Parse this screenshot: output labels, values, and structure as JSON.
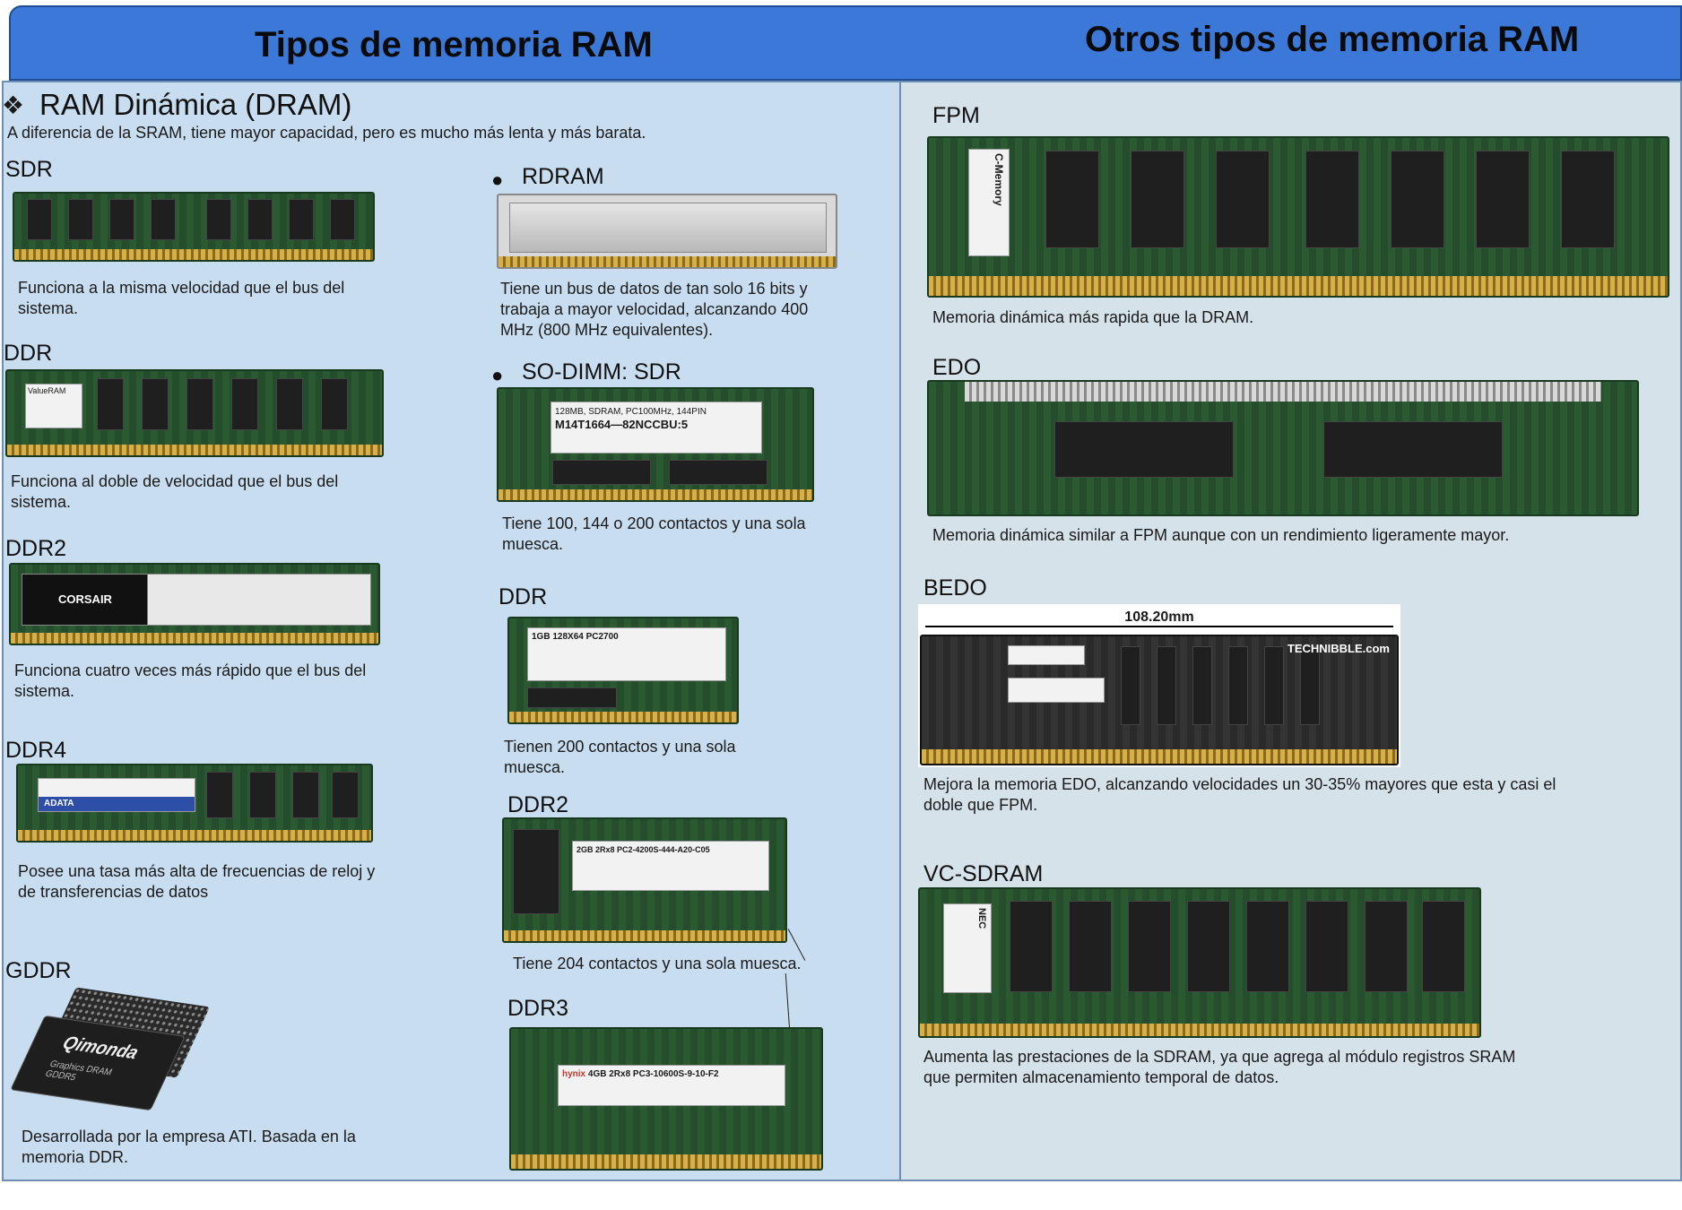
{
  "header": {
    "left_title": "Tipos de memoria RAM",
    "right_title": "Otros tipos de memoria RAM"
  },
  "colors": {
    "header_bg": "#3c78d8",
    "left_panel_bg": "#c9ddf1",
    "right_panel_bg": "#d5e2ea",
    "pcb_green": "#2b5a32",
    "pins_gold": "#d8b04a"
  },
  "left": {
    "section_symbol": "❖",
    "section_title": "RAM Dinámica (DRAM)",
    "section_intro": "A diferencia de la SRAM, tiene mayor capacidad, pero es mucho más lenta y más barata.",
    "col1": [
      {
        "label": "SDR",
        "desc": "Funciona a la misma velocidad que el bus del sistema."
      },
      {
        "label": "DDR",
        "desc": "Funciona al doble de velocidad que el bus del sistema."
      },
      {
        "label": "DDR2",
        "desc": "Funciona cuatro veces más rápido que el bus del sistema."
      },
      {
        "label": "DDR4",
        "desc": "Posee una tasa más alta de frecuencias de reloj y de transferencias de datos"
      },
      {
        "label": "GDDR",
        "desc": "Desarrollada por la empresa ATI. Basada en la memoria DDR."
      }
    ],
    "col2": [
      {
        "bullet": "●",
        "label": "RDRAM",
        "desc": "Tiene un bus de datos de tan solo 16 bits y trabaja a mayor velocidad, alcanzando 400 MHz (800 MHz equivalentes)."
      },
      {
        "bullet": "●",
        "label": "SO-DIMM: SDR",
        "desc": "Tiene 100, 144 o 200 contactos y una sola muesca."
      },
      {
        "label": "DDR",
        "desc": "Tienen 200 contactos y una sola muesca."
      },
      {
        "label": "DDR2",
        "desc": "Tiene 204 contactos y una sola muesca."
      },
      {
        "label": "DDR3",
        "desc": ""
      }
    ]
  },
  "right": {
    "items": [
      {
        "label": "FPM",
        "desc": "Memoria dinámica más rapida que la DRAM."
      },
      {
        "label": "EDO",
        "desc": "Memoria dinámica similar a FPM aunque con un rendimiento ligeramente mayor."
      },
      {
        "label": "BEDO",
        "desc": "Mejora la memoria EDO, alcanzando velocidades un 30-35% mayores que esta y casi el doble que FPM."
      },
      {
        "label": "VC-SDRAM",
        "desc": "Aumenta las prestaciones de la SDRAM, ya que agrega al módulo registros SRAM que permiten almacenamiento temporal de datos."
      }
    ]
  },
  "image_labels": {
    "ddr_valueram": "ValueRAM",
    "ddr2_brand": "CORSAIR",
    "ddr4_brand": "ADATA",
    "gddr_brand": "Qimonda",
    "gddr_sub": "Graphics DRAM GDDR5",
    "sodimm_sdr_sticker": "128MB, SDRAM, PC100MHz, 144PIN",
    "sodimm_sdr_part": "M14T1664—82NCCBU:5",
    "sodimm_ddr_sticker": "1GB 128X64 PC2700",
    "sodimm_ddr2_sticker": "2GB 2Rx8 PC2-4200S-444-A20-C05",
    "sodimm_ddr3_brand": "hynix",
    "sodimm_ddr3_sticker": "4GB 2Rx8 PC3-10600S-9-10-F2",
    "fpm_brand": "C-Memory",
    "bedo_measure": "108.20mm",
    "bedo_watermark": "TECHNIBBLE.com",
    "vc_brand": "NEC"
  }
}
